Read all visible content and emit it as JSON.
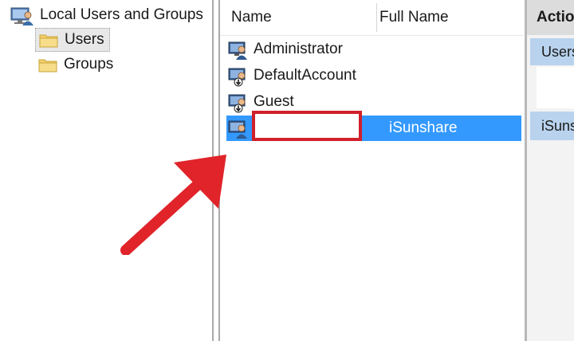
{
  "tree": {
    "root_label": "Local Users and Groups",
    "items": [
      {
        "label": "Users",
        "selected": true
      },
      {
        "label": "Groups",
        "selected": false
      }
    ]
  },
  "list": {
    "columns": {
      "name": "Name",
      "full_name": "Full Name"
    },
    "rows": [
      {
        "name": "Administrator",
        "full_name": ""
      },
      {
        "name": "DefaultAccount",
        "full_name": ""
      },
      {
        "name": "Guest",
        "full_name": ""
      },
      {
        "name": "",
        "full_name": "iSunshare",
        "selected": true
      }
    ]
  },
  "actions": {
    "header": "Actio",
    "section_label": "Users",
    "selected_label": "iSuns"
  },
  "colors": {
    "selection": "#3399ff",
    "highlight_box": "#d0202a",
    "arrow": "#e0242a"
  },
  "icons": {
    "root": "users-group-icon",
    "folder": "folder-icon",
    "user": "user-icon",
    "arrow": "pointer-arrow"
  }
}
